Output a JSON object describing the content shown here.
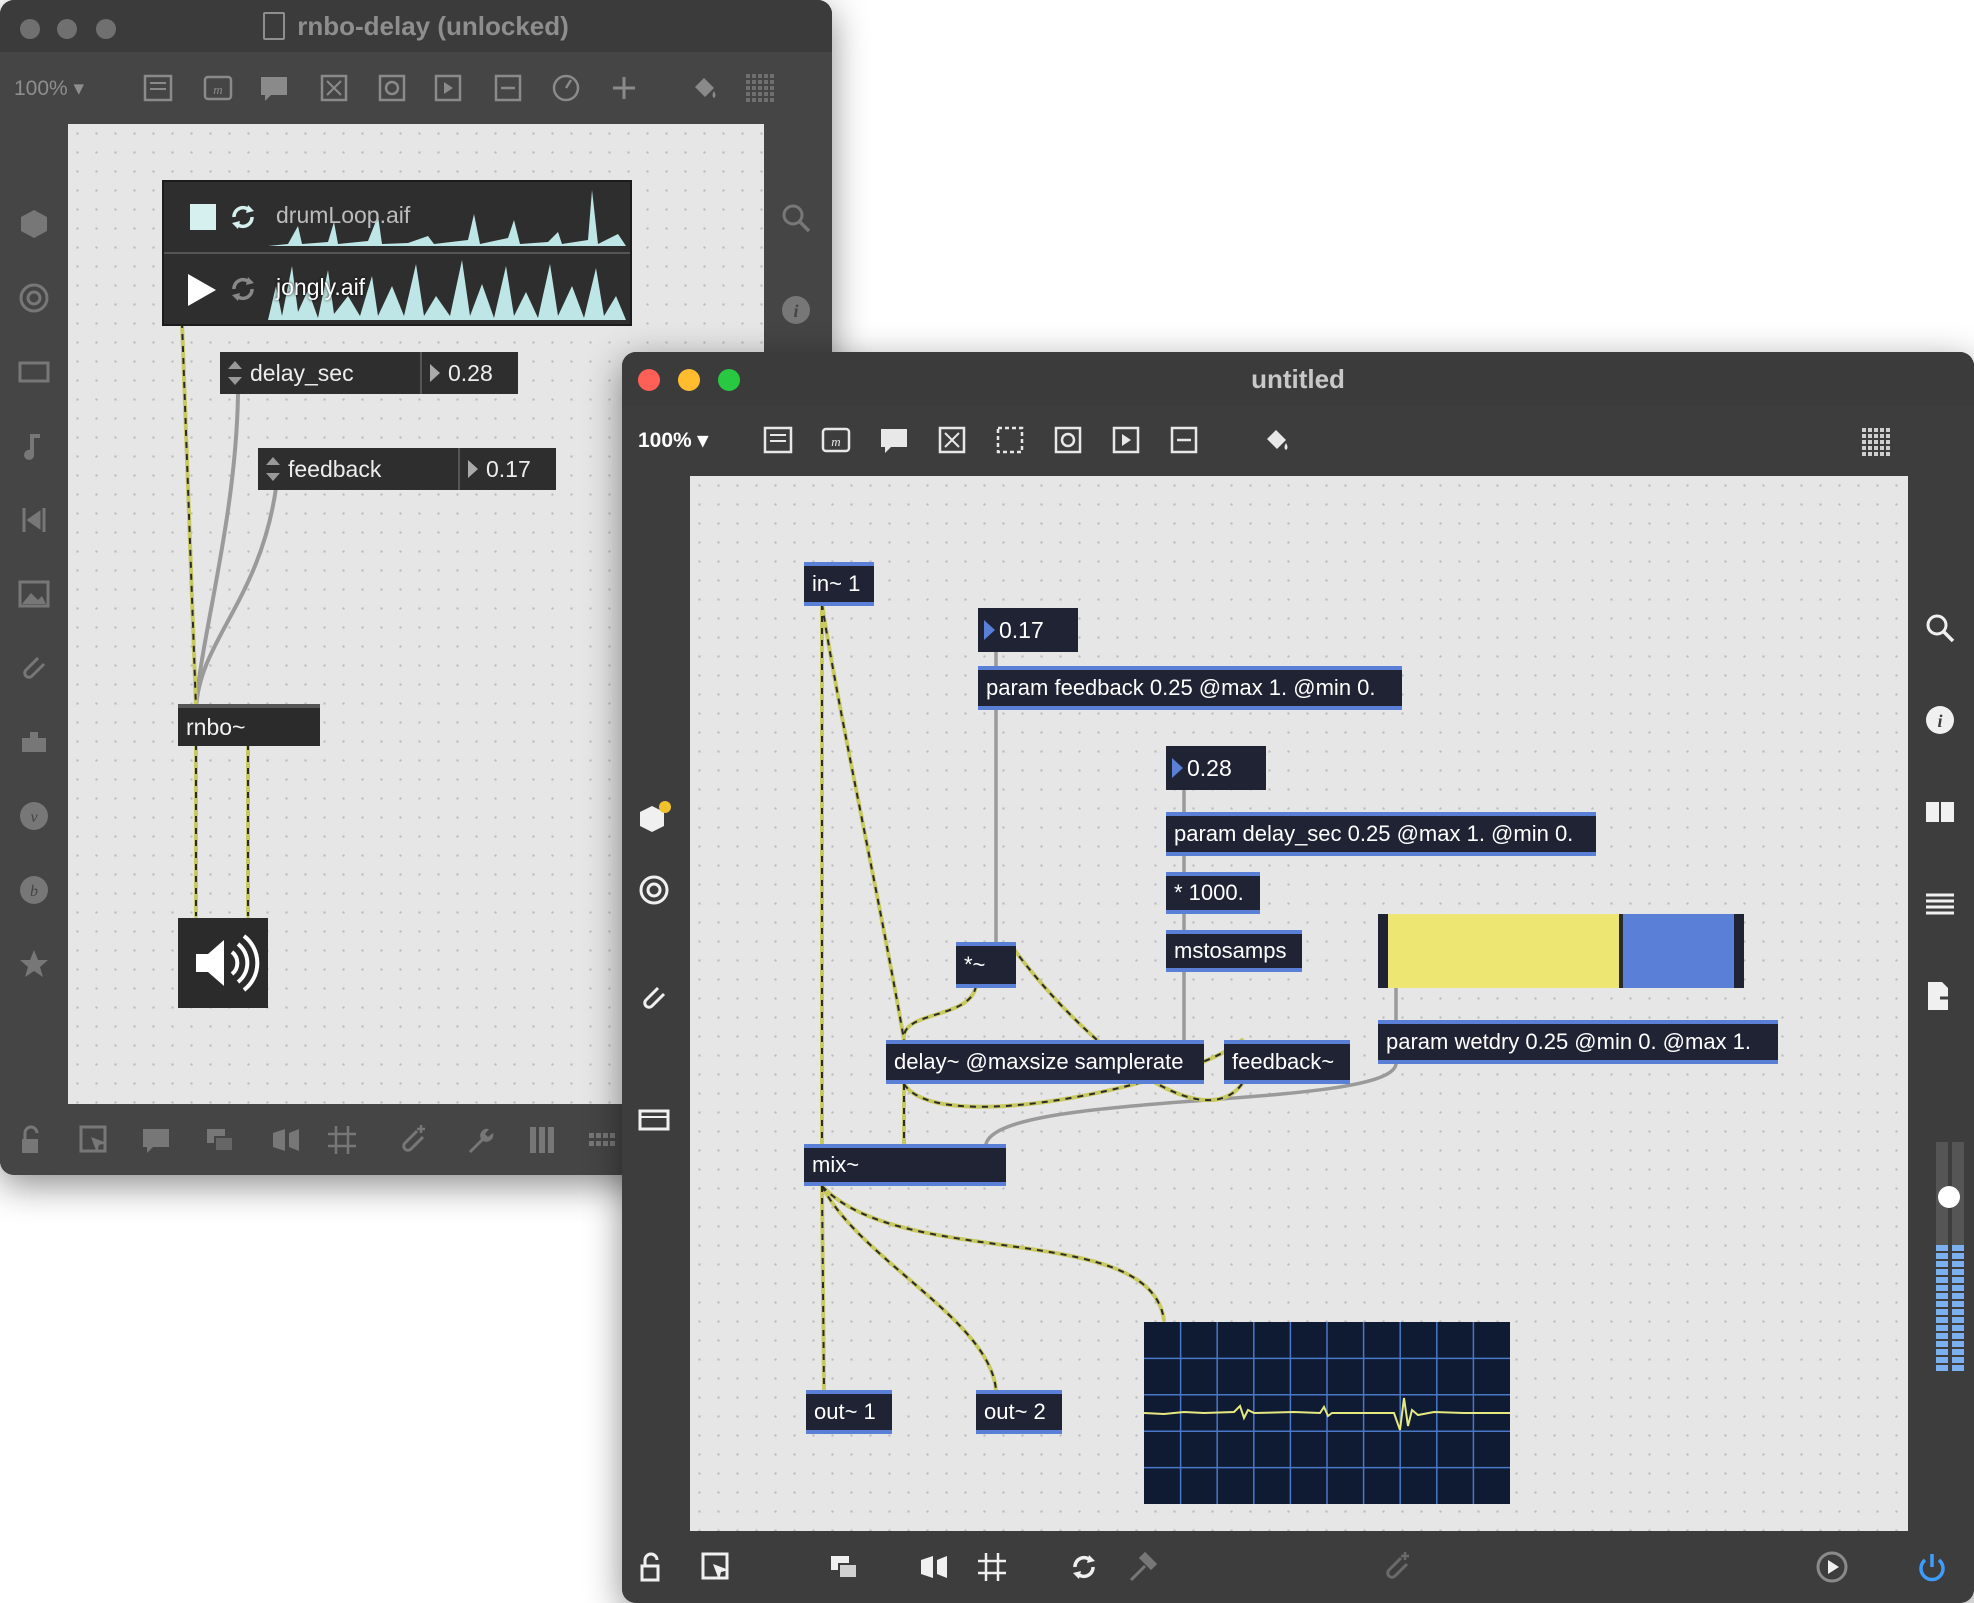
{
  "back_window": {
    "title": "rnbo-delay (unlocked)",
    "zoom": "100%",
    "objects": {
      "playlist": {
        "item1": "drumLoop.aif",
        "item2": "jongly.aif"
      },
      "delay_param": {
        "name": "delay_sec",
        "value": "0.28"
      },
      "feedback_param": {
        "name": "feedback",
        "value": "0.17"
      },
      "rnbo": "rnbo~"
    }
  },
  "front_window": {
    "title": "untitled",
    "zoom": "100%",
    "objects": {
      "in": "in~ 1",
      "num_feedback": "0.17",
      "param_feedback": "param feedback 0.25 @max 1. @min 0.",
      "num_delay": "0.28",
      "param_delay": "param delay_sec 0.25 @max 1. @min 0.",
      "mult1000": "* 1000.",
      "mstosamps": "mstosamps",
      "multsig": "*~",
      "delay": "delay~ @maxsize samplerate",
      "feedback_obj": "feedback~",
      "param_wetdry": "param wetdry 0.25 @min 0. @max 1.",
      "mix": "mix~",
      "out1": "out~ 1",
      "out2": "out~ 2"
    },
    "slider_value": 0.68,
    "meter_level": 0.55
  },
  "colors": {
    "patch_cord": "#c9c962",
    "object_bg": "#1f2333",
    "object_border": "#5a7fd6",
    "slider_fill": "#ede672",
    "slider_rest": "#5a7fd6"
  }
}
